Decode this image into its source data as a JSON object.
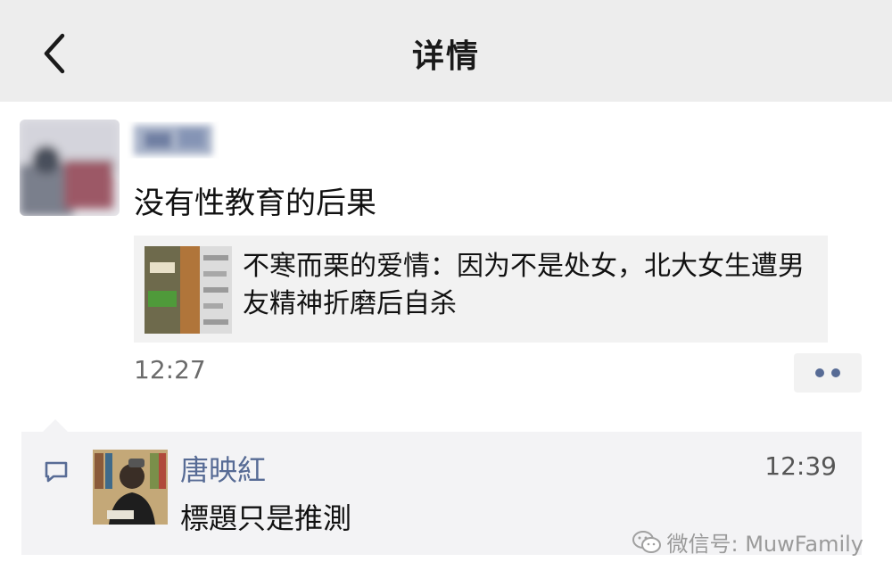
{
  "nav": {
    "title": "详情",
    "back_icon": "chevron-left-icon"
  },
  "post": {
    "text": "没有性教育的后果",
    "time": "12:27",
    "more_icon": "more-dots-icon",
    "link": {
      "title": "不寒而栗的爱情：因为不是处女，北大女生遭男友精神折磨后自杀"
    }
  },
  "comment": {
    "icon": "comment-bubble-icon",
    "author": "唐映紅",
    "time": "12:39",
    "text": "標題只是推測"
  },
  "watermark": {
    "text": "微信号: MuwFamily",
    "icon": "wechat-icon"
  },
  "colors": {
    "nav_bg": "#ededed",
    "link_blue": "#576b95",
    "card_bg": "#f2f2f2",
    "comment_bg": "#f3f3f5"
  }
}
